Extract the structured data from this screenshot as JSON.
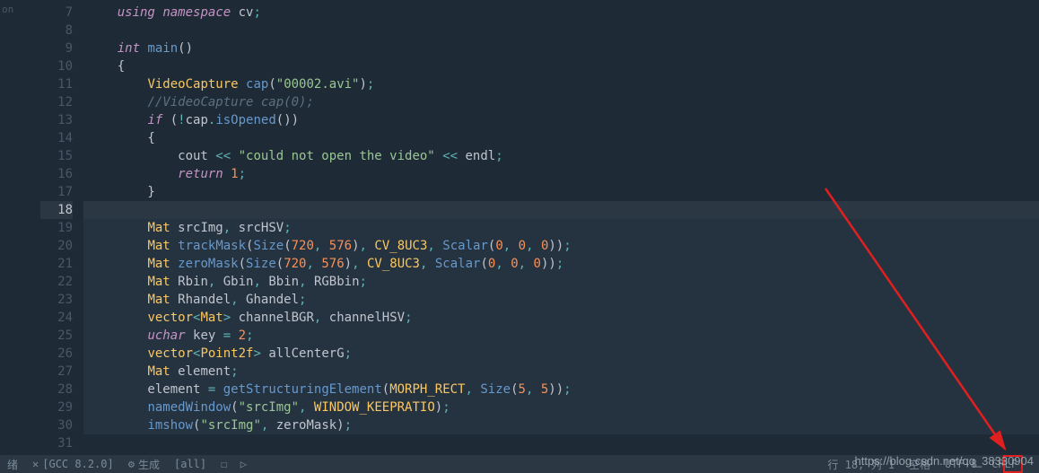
{
  "leftStrip": "on",
  "gutter_start": 7,
  "gutter_end": 31,
  "highlighted_line": 18,
  "code_lines": {
    "7": [
      [
        "kw",
        "using"
      ],
      [
        "pn",
        " "
      ],
      [
        "kw",
        "namespace"
      ],
      [
        "pn",
        " cv"
      ],
      [
        "op",
        ";"
      ]
    ],
    "8": [
      [
        "pn",
        ""
      ]
    ],
    "9": [
      [
        "type",
        "int"
      ],
      [
        "pn",
        " "
      ],
      [
        "fn",
        "main"
      ],
      [
        "pn",
        "()"
      ]
    ],
    "10": [
      [
        "pn",
        "{"
      ]
    ],
    "11": [
      [
        "pn",
        "    "
      ],
      [
        "tp",
        "VideoCapture"
      ],
      [
        "pn",
        " "
      ],
      [
        "fn",
        "cap"
      ],
      [
        "pn",
        "("
      ],
      [
        "str",
        "\"00002.avi\""
      ],
      [
        "pn",
        ")"
      ],
      [
        "op",
        ";"
      ]
    ],
    "12": [
      [
        "pn",
        "    "
      ],
      [
        "cmt",
        "//VideoCapture cap(0);"
      ]
    ],
    "13": [
      [
        "pn",
        "    "
      ],
      [
        "kw",
        "if"
      ],
      [
        "pn",
        " ("
      ],
      [
        "op",
        "!"
      ],
      [
        "pn",
        "cap"
      ],
      [
        "op",
        "."
      ],
      [
        "fn",
        "isOpened"
      ],
      [
        "pn",
        "())"
      ]
    ],
    "14": [
      [
        "pn",
        "    {"
      ]
    ],
    "15": [
      [
        "pn",
        "        cout "
      ],
      [
        "op",
        "<<"
      ],
      [
        "pn",
        " "
      ],
      [
        "str",
        "\"could not open the video\""
      ],
      [
        "pn",
        " "
      ],
      [
        "op",
        "<<"
      ],
      [
        "pn",
        " endl"
      ],
      [
        "op",
        ";"
      ]
    ],
    "16": [
      [
        "pn",
        "        "
      ],
      [
        "kw",
        "return"
      ],
      [
        "pn",
        " "
      ],
      [
        "num",
        "1"
      ],
      [
        "op",
        ";"
      ]
    ],
    "17": [
      [
        "pn",
        "    }"
      ]
    ],
    "18": [
      [
        "pn",
        ""
      ]
    ],
    "19": [
      [
        "pn",
        "    "
      ],
      [
        "tp",
        "Mat"
      ],
      [
        "pn",
        " srcImg"
      ],
      [
        "op",
        ","
      ],
      [
        "pn",
        " srcHSV"
      ],
      [
        "op",
        ";"
      ]
    ],
    "20": [
      [
        "pn",
        "    "
      ],
      [
        "tp",
        "Mat"
      ],
      [
        "pn",
        " "
      ],
      [
        "fn",
        "trackMask"
      ],
      [
        "pn",
        "("
      ],
      [
        "fn",
        "Size"
      ],
      [
        "pn",
        "("
      ],
      [
        "num",
        "720"
      ],
      [
        "op",
        ","
      ],
      [
        "pn",
        " "
      ],
      [
        "num",
        "576"
      ],
      [
        "pn",
        ")"
      ],
      [
        "op",
        ","
      ],
      [
        "pn",
        " "
      ],
      [
        "mac",
        "CV_8UC3"
      ],
      [
        "op",
        ","
      ],
      [
        "pn",
        " "
      ],
      [
        "fn",
        "Scalar"
      ],
      [
        "pn",
        "("
      ],
      [
        "num",
        "0"
      ],
      [
        "op",
        ","
      ],
      [
        "pn",
        " "
      ],
      [
        "num",
        "0"
      ],
      [
        "op",
        ","
      ],
      [
        "pn",
        " "
      ],
      [
        "num",
        "0"
      ],
      [
        "pn",
        "))"
      ],
      [
        "op",
        ";"
      ]
    ],
    "21": [
      [
        "pn",
        "    "
      ],
      [
        "tp",
        "Mat"
      ],
      [
        "pn",
        " "
      ],
      [
        "fn",
        "zeroMask"
      ],
      [
        "pn",
        "("
      ],
      [
        "fn",
        "Size"
      ],
      [
        "pn",
        "("
      ],
      [
        "num",
        "720"
      ],
      [
        "op",
        ","
      ],
      [
        "pn",
        " "
      ],
      [
        "num",
        "576"
      ],
      [
        "pn",
        ")"
      ],
      [
        "op",
        ","
      ],
      [
        "pn",
        " "
      ],
      [
        "mac",
        "CV_8UC3"
      ],
      [
        "op",
        ","
      ],
      [
        "pn",
        " "
      ],
      [
        "fn",
        "Scalar"
      ],
      [
        "pn",
        "("
      ],
      [
        "num",
        "0"
      ],
      [
        "op",
        ","
      ],
      [
        "pn",
        " "
      ],
      [
        "num",
        "0"
      ],
      [
        "op",
        ","
      ],
      [
        "pn",
        " "
      ],
      [
        "num",
        "0"
      ],
      [
        "pn",
        "))"
      ],
      [
        "op",
        ";"
      ]
    ],
    "22": [
      [
        "pn",
        "    "
      ],
      [
        "tp",
        "Mat"
      ],
      [
        "pn",
        " Rbin"
      ],
      [
        "op",
        ","
      ],
      [
        "pn",
        " Gbin"
      ],
      [
        "op",
        ","
      ],
      [
        "pn",
        " Bbin"
      ],
      [
        "op",
        ","
      ],
      [
        "pn",
        " RGBbin"
      ],
      [
        "op",
        ";"
      ]
    ],
    "23": [
      [
        "pn",
        "    "
      ],
      [
        "tp",
        "Mat"
      ],
      [
        "pn",
        " Rhandel"
      ],
      [
        "op",
        ","
      ],
      [
        "pn",
        " Ghandel"
      ],
      [
        "op",
        ";"
      ]
    ],
    "24": [
      [
        "pn",
        "    "
      ],
      [
        "tp",
        "vector"
      ],
      [
        "op",
        "<"
      ],
      [
        "tp",
        "Mat"
      ],
      [
        "op",
        ">"
      ],
      [
        "pn",
        " channelBGR"
      ],
      [
        "op",
        ","
      ],
      [
        "pn",
        " channelHSV"
      ],
      [
        "op",
        ";"
      ]
    ],
    "25": [
      [
        "pn",
        "    "
      ],
      [
        "type",
        "uchar"
      ],
      [
        "pn",
        " key "
      ],
      [
        "op",
        "="
      ],
      [
        "pn",
        " "
      ],
      [
        "num",
        "2"
      ],
      [
        "op",
        ";"
      ]
    ],
    "26": [
      [
        "pn",
        "    "
      ],
      [
        "tp",
        "vector"
      ],
      [
        "op",
        "<"
      ],
      [
        "tp",
        "Point2f"
      ],
      [
        "op",
        ">"
      ],
      [
        "pn",
        " allCenterG"
      ],
      [
        "op",
        ";"
      ]
    ],
    "27": [
      [
        "pn",
        "    "
      ],
      [
        "tp",
        "Mat"
      ],
      [
        "pn",
        " element"
      ],
      [
        "op",
        ";"
      ]
    ],
    "28": [
      [
        "pn",
        "    element "
      ],
      [
        "op",
        "="
      ],
      [
        "pn",
        " "
      ],
      [
        "fn",
        "getStructuringElement"
      ],
      [
        "pn",
        "("
      ],
      [
        "mac",
        "MORPH_RECT"
      ],
      [
        "op",
        ","
      ],
      [
        "pn",
        " "
      ],
      [
        "fn",
        "Size"
      ],
      [
        "pn",
        "("
      ],
      [
        "num",
        "5"
      ],
      [
        "op",
        ","
      ],
      [
        "pn",
        " "
      ],
      [
        "num",
        "5"
      ],
      [
        "pn",
        "))"
      ],
      [
        "op",
        ";"
      ]
    ],
    "29": [
      [
        "pn",
        "    "
      ],
      [
        "fn",
        "namedWindow"
      ],
      [
        "pn",
        "("
      ],
      [
        "str",
        "\"srcImg\""
      ],
      [
        "op",
        ","
      ],
      [
        "pn",
        " "
      ],
      [
        "mac",
        "WINDOW_KEEPRATIO"
      ],
      [
        "pn",
        ")"
      ],
      [
        "op",
        ";"
      ]
    ],
    "30": [
      [
        "pn",
        "    "
      ],
      [
        "fn",
        "imshow"
      ],
      [
        "pn",
        "("
      ],
      [
        "str",
        "\"srcImg\""
      ],
      [
        "op",
        ","
      ],
      [
        "pn",
        " zeroMask)"
      ],
      [
        "op",
        ";"
      ]
    ],
    "31": [
      [
        "pn",
        ""
      ]
    ]
  },
  "statusbar": {
    "left1": "绪",
    "left2": "[GCC 8.2.0]",
    "left3": "生成",
    "left4": "[all]",
    "cursor": "行 18,  列 1",
    "spaces": "空格",
    "encoding": "UTF-8",
    "eol": "CRLF"
  },
  "watermark": "https://blog.csdn.net/qq_38330904"
}
